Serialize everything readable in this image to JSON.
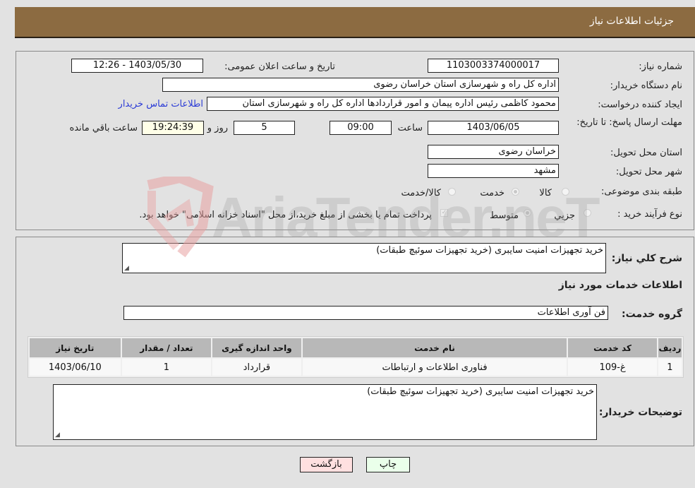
{
  "header": {
    "title": "جزئیات اطلاعات نیاز"
  },
  "form": {
    "need_number": {
      "label": "شماره نیاز:",
      "value": "1103003374000017"
    },
    "announce_datetime": {
      "label": "تاریخ و ساعت اعلان عمومی:",
      "value": "1403/05/30 - 12:26"
    },
    "buyer_org": {
      "label": "نام دستگاه خریدار:",
      "value": "اداره کل راه و شهرسازی استان خراسان رضوی"
    },
    "requester": {
      "label": "ایجاد کننده درخواست:",
      "value": "محمود کاظمی رئیس اداره پیمان و امور قراردادها اداره کل راه و شهرسازی استان",
      "contact_link": "اطلاعات تماس خریدار"
    },
    "deadline": {
      "label": "مهلت ارسال پاسخ: تا تاریخ:",
      "date": "1403/06/05",
      "time_label": "ساعت",
      "time": "09:00",
      "days": "5",
      "days_label": "روز و",
      "remaining": "19:24:39",
      "remaining_label": "ساعت باقي مانده"
    },
    "delivery_province": {
      "label": "استان محل تحویل:",
      "value": "خراسان رضوی"
    },
    "delivery_city": {
      "label": "شهر محل تحویل:",
      "value": "مشهد"
    },
    "category": {
      "label": "طبقه بندی موضوعی:",
      "options": [
        "کالا",
        "خدمت",
        "کالا/خدمت"
      ],
      "selected": "خدمت"
    },
    "process_type": {
      "label": "نوع فرآیند خرید :",
      "options": [
        "جزیي",
        "متوسط"
      ],
      "selected": "متوسط",
      "payment_note": "پرداخت تمام یا بخشی از مبلغ خرید،از محل \"اسناد خزانه اسلامی\" خواهد بود.",
      "payment_checked": true
    }
  },
  "summary": {
    "label": "شرح کلي نياز:",
    "value": "خرید تجهیزات امنیت سایبری (خرید تجهیزات سوئیچ طبقات)"
  },
  "services": {
    "section_title": "اطلاعات خدمات مورد نياز",
    "group_label": "گروه خدمت:",
    "group_value": "فن آوری اطلاعات",
    "table": {
      "headers": [
        "ردیف",
        "کد خدمت",
        "نام خدمت",
        "واحد اندازه گیری",
        "تعداد / مقدار",
        "تاریخ نیاز"
      ],
      "rows": [
        [
          "1",
          "غ-109",
          "فناوری اطلاعات و ارتباطات",
          "قرارداد",
          "1",
          "1403/06/10"
        ]
      ]
    }
  },
  "buyer_notes": {
    "label": "توضیحات خریدار:",
    "value": "خرید تجهیزات امنیت سایبری (خرید تجهیزات سوئیچ طبقات)"
  },
  "buttons": {
    "print": "چاپ",
    "back": "بازگشت"
  },
  "watermark": {
    "text": "AriaTender.neT"
  },
  "colors": {
    "header_bg": "#8c6b41",
    "link": "#2b3bd6",
    "print_bg": "#eaffea",
    "back_bg": "#ffe0e0",
    "remaining_bg": "#ffffe8"
  }
}
